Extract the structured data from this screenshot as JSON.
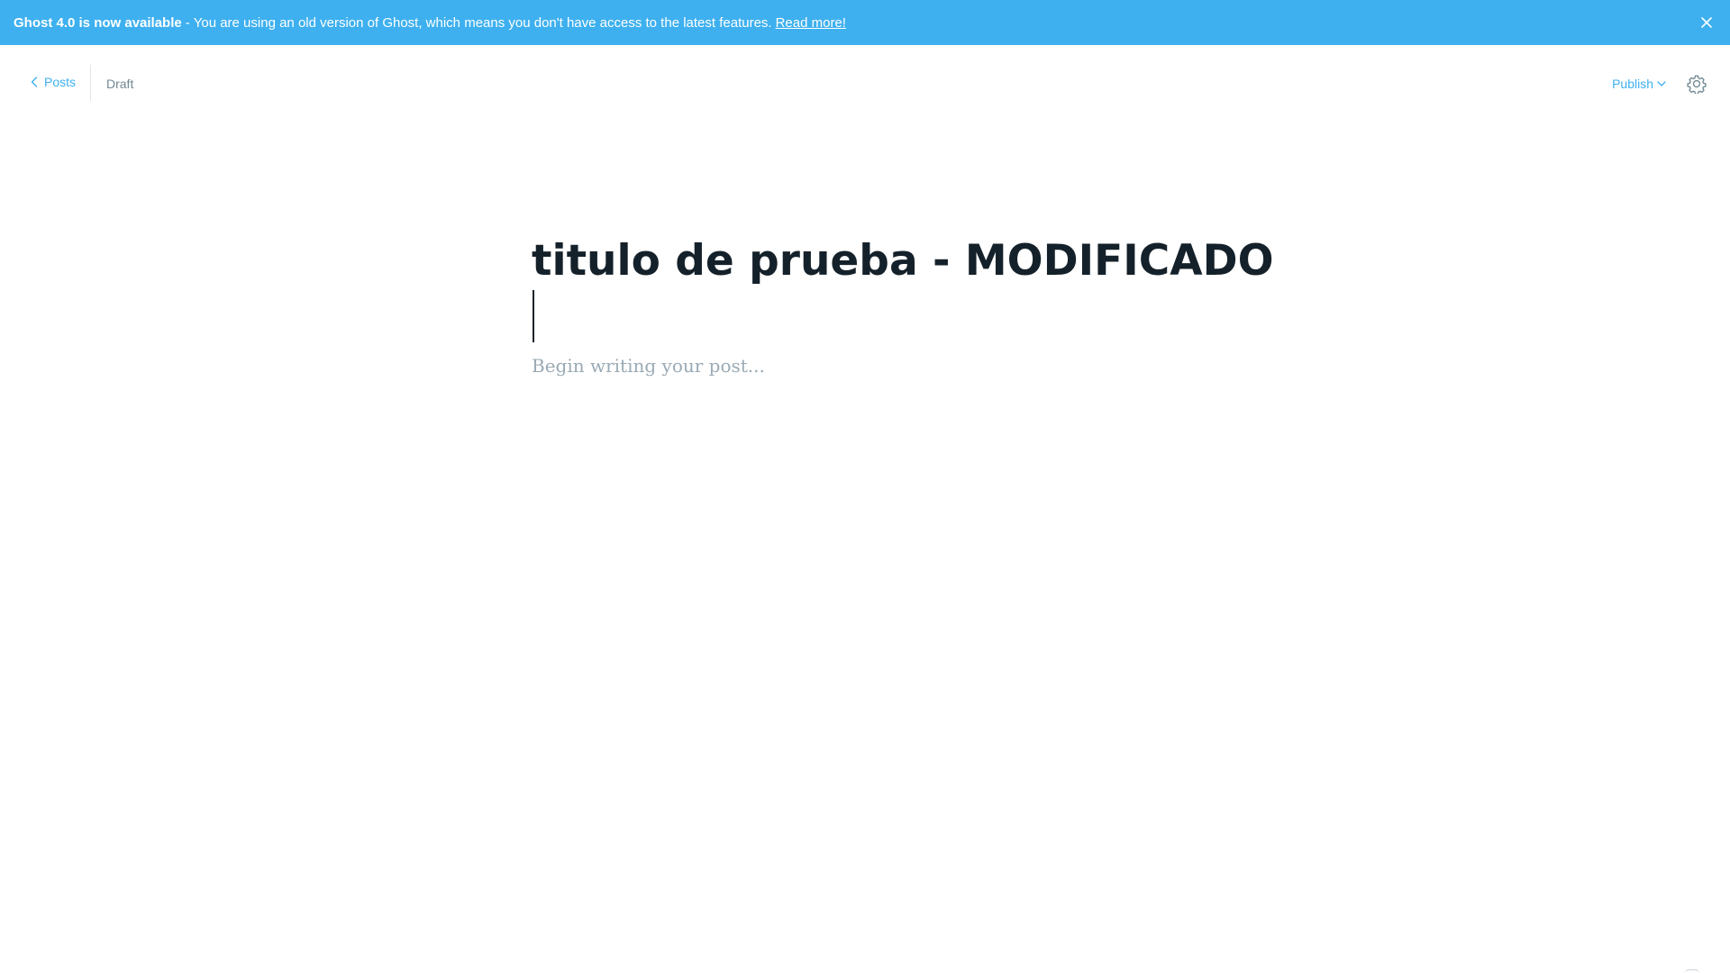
{
  "banner": {
    "headline": "Ghost 4.0 is now available",
    "separator": "-",
    "message": "You are using an old version of Ghost, which means you don't have access to the latest features.",
    "link": "Read more!",
    "close_icon": "close-icon",
    "background_color": "#3eb0ef"
  },
  "topbar": {
    "back_label": "Posts",
    "back_icon": "chevron-left-icon",
    "status": "Draft",
    "publish_label": "Publish",
    "publish_icon": "chevron-down-icon",
    "settings_icon": "gear-icon"
  },
  "editor": {
    "title": "titulo de prueba - MODIFICADO",
    "body_placeholder": "Begin writing your post..."
  },
  "colors": {
    "accent": "#3eb0ef",
    "title_text": "#15212a",
    "muted_text": "#738a94",
    "placeholder": "#9aaab5"
  }
}
